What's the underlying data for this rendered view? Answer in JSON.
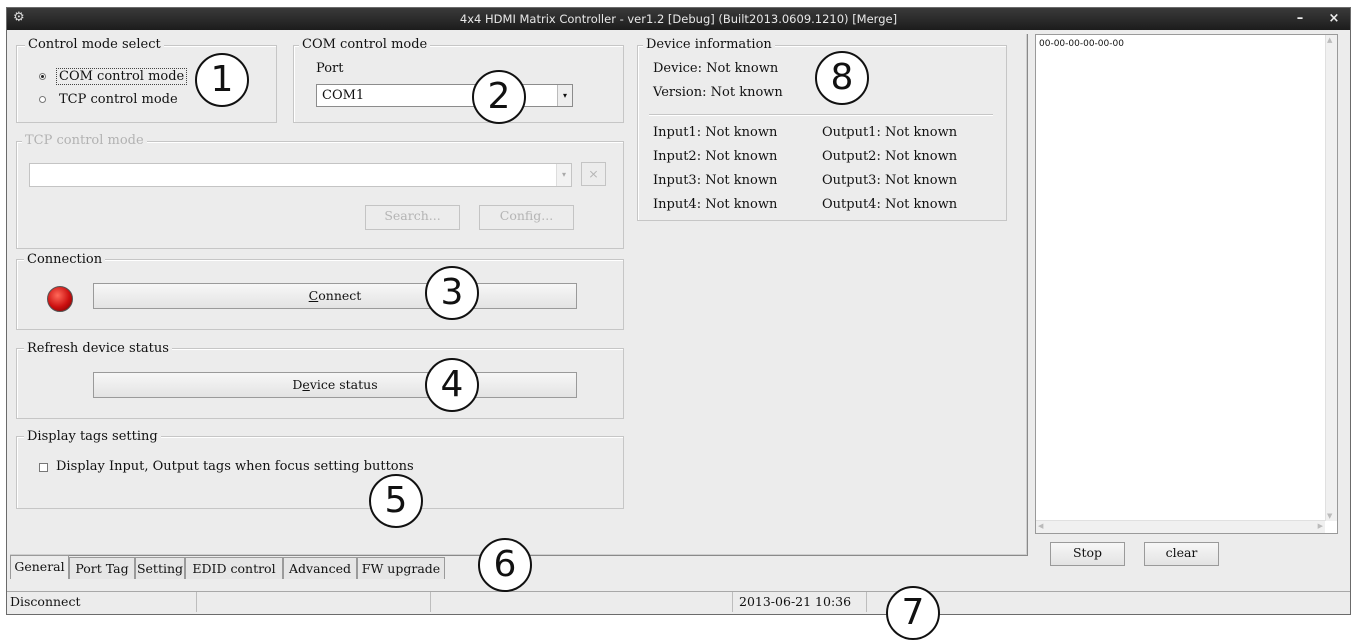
{
  "window": {
    "title": "4x4 HDMI Matrix Controller - ver1.2 [Debug]  (Built2013.0609.1210) [Merge]",
    "minimize_glyph": "–",
    "close_glyph": "×"
  },
  "control_mode": {
    "title": "Control mode select",
    "options": [
      "COM control mode",
      "TCP control mode"
    ],
    "selected": "COM control mode"
  },
  "com_mode": {
    "title": "COM control mode",
    "port_label": "Port",
    "port_value": "COM1"
  },
  "tcp_mode": {
    "title": "TCP control mode",
    "address_value": "",
    "delete_glyph": "×",
    "search_label": "Search...",
    "config_label": "Config..."
  },
  "connection": {
    "title": "Connection",
    "connect_label": "Connect",
    "connect_mnemonic": "C",
    "connect_rest": "onnect",
    "led_color": "#cc1010"
  },
  "refresh": {
    "title": "Refresh device status",
    "device_status_pre": "D",
    "device_status_mnemonic": "e",
    "device_status_rest": "vice status"
  },
  "display_tags": {
    "title": "Display tags setting",
    "checkbox_label": "Display Input, Output tags when focus setting buttons",
    "checked": false
  },
  "device_info": {
    "title": "Device information",
    "device": "Device: Not known",
    "version": "Version: Not known",
    "inputs": [
      "Input1: Not known",
      "Input2: Not known",
      "Input3: Not known",
      "Input4: Not known"
    ],
    "outputs": [
      "Output1: Not known",
      "Output2: Not known",
      "Output3: Not known",
      "Output4: Not known"
    ]
  },
  "tabs": [
    "General",
    "Port Tag",
    "Setting",
    "EDID control",
    "Advanced",
    "FW upgrade"
  ],
  "active_tab": "General",
  "log": {
    "lines": [
      "00-00-00-00-00-00"
    ],
    "stop_label": "Stop",
    "clear_label": "clear"
  },
  "status_bar": {
    "connection_state": "Disconnect",
    "cell2": "",
    "cell3": "",
    "datetime": "2013-06-21 10:36",
    "cell5": ""
  },
  "callouts": [
    "1",
    "2",
    "3",
    "4",
    "5",
    "6",
    "7",
    "8"
  ]
}
